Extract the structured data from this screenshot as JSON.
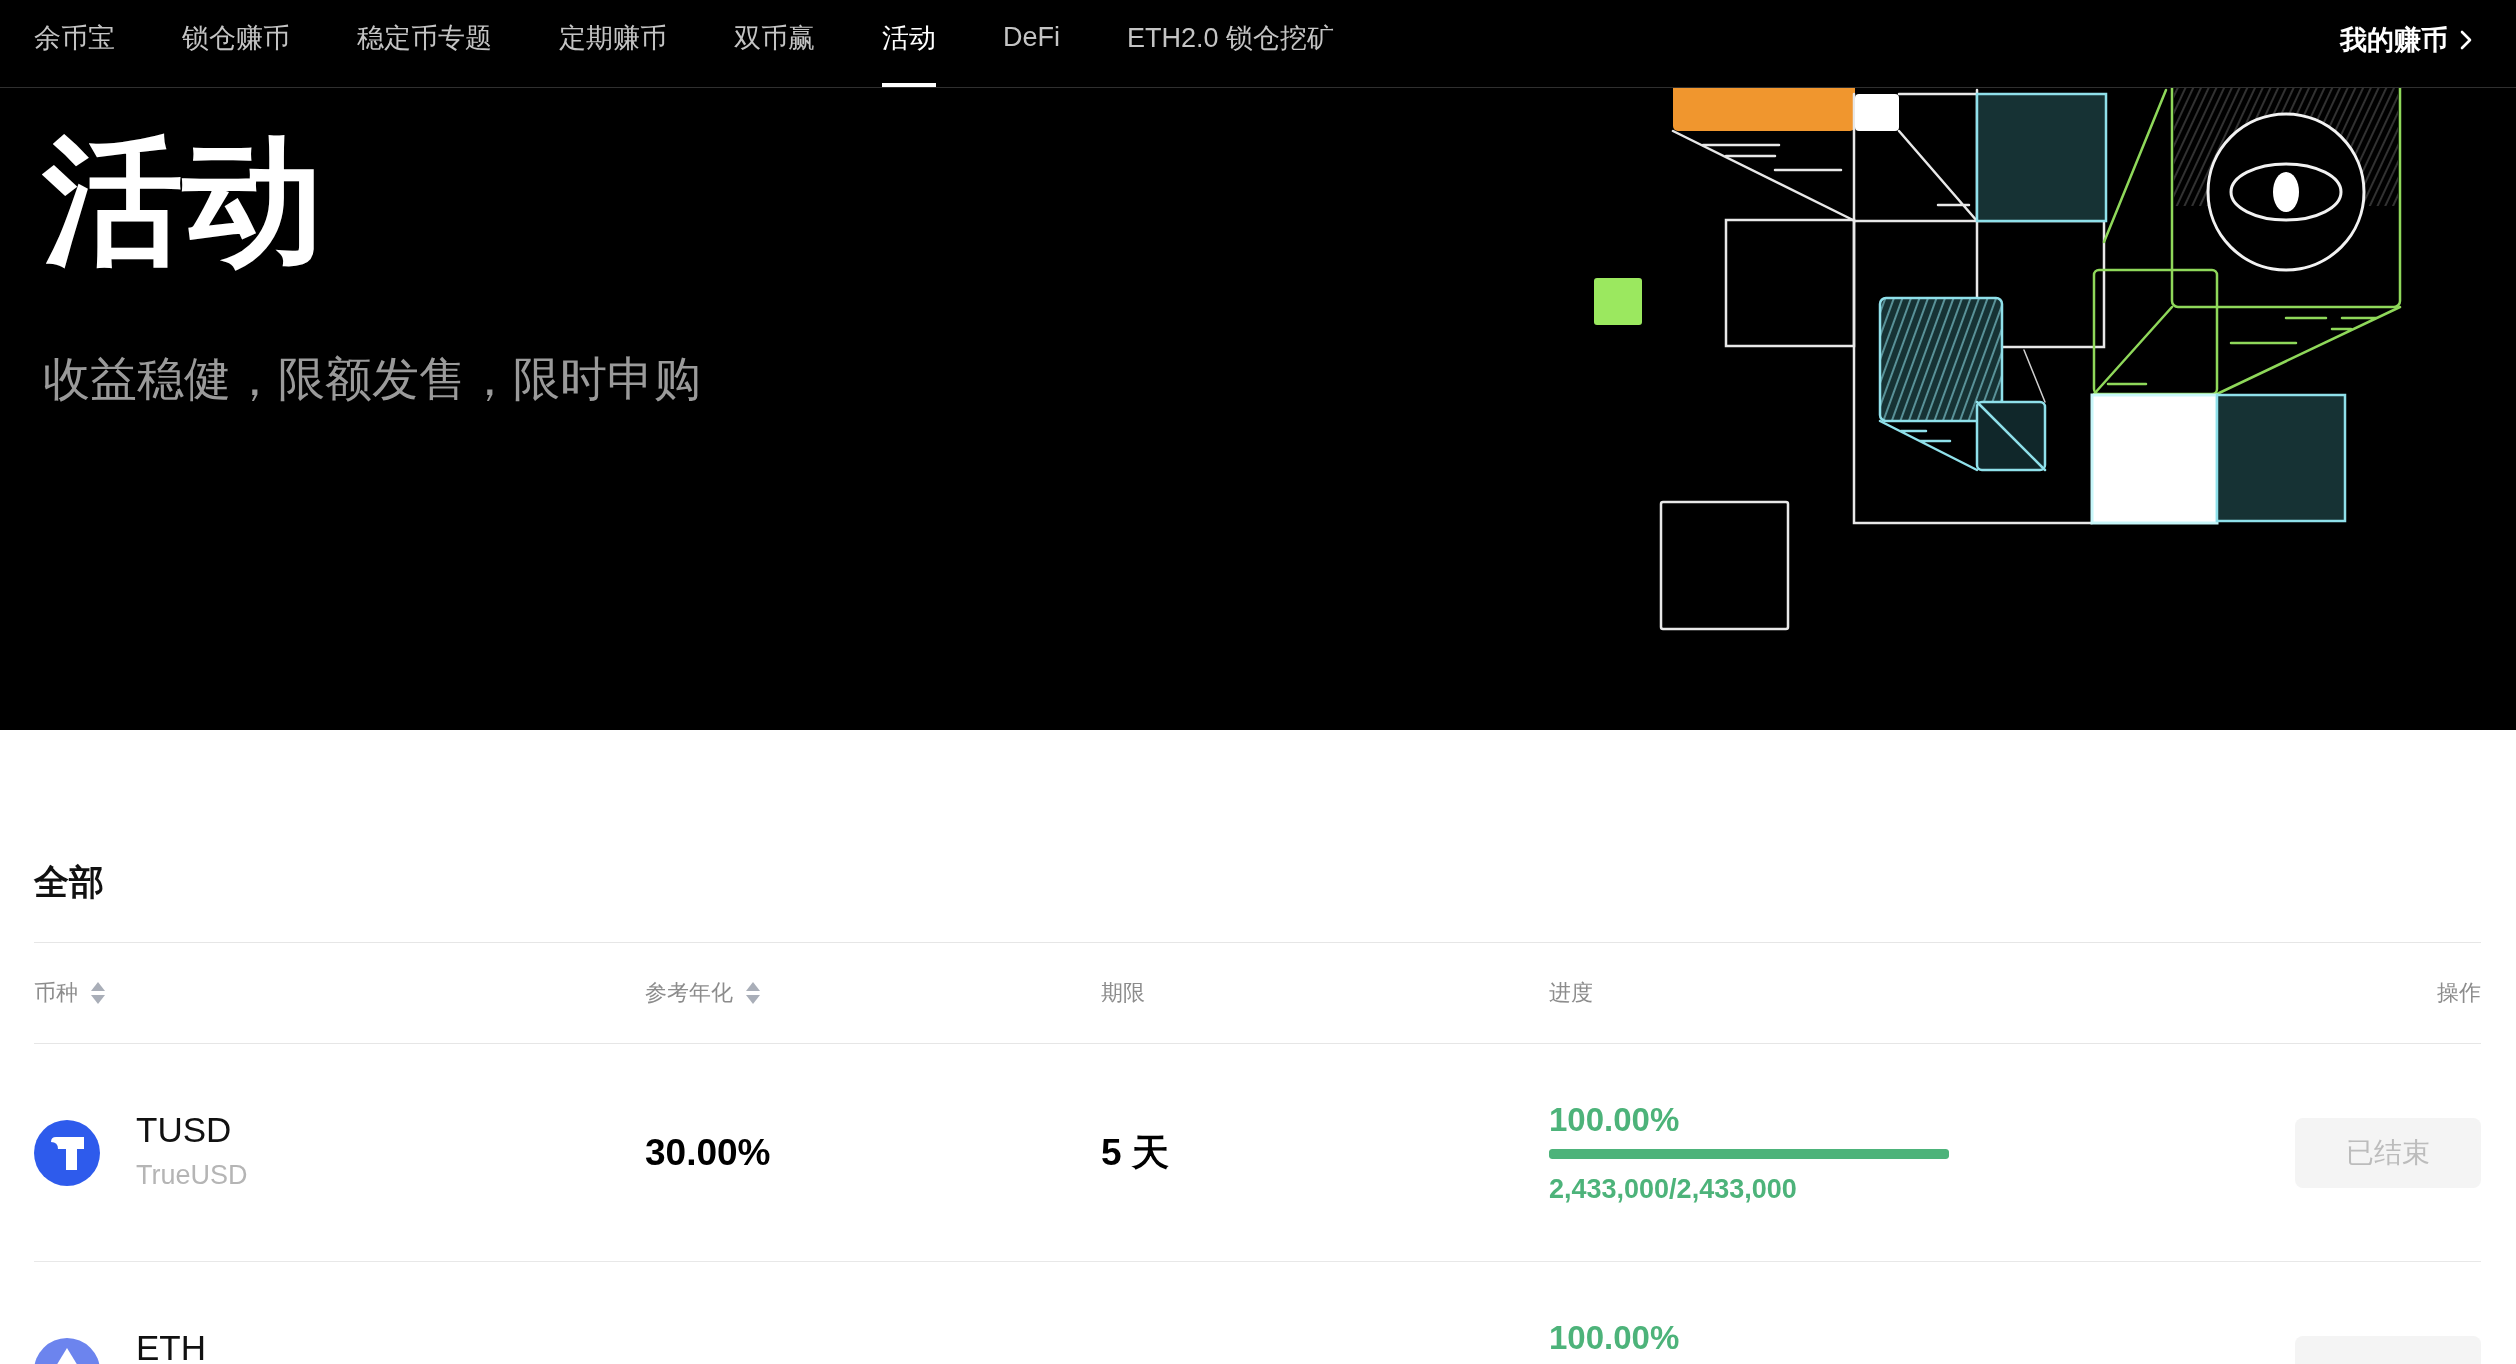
{
  "nav": {
    "tabs": [
      {
        "label": "余币宝",
        "selected": false
      },
      {
        "label": "锁仓赚币",
        "selected": false
      },
      {
        "label": "稳定币专题",
        "selected": false
      },
      {
        "label": "定期赚币",
        "selected": false
      },
      {
        "label": "双币赢",
        "selected": false
      },
      {
        "label": "活动",
        "selected": true
      },
      {
        "label": "DeFi",
        "selected": false
      },
      {
        "label": "ETH2.0 锁仓挖矿",
        "selected": false
      }
    ],
    "my_earnings": "我的赚币"
  },
  "hero": {
    "title": "活动",
    "subtitle": "收益稳健，限额发售，限时申购"
  },
  "section": {
    "title": "全部"
  },
  "table": {
    "columns": [
      {
        "label": "币种",
        "sortable": true
      },
      {
        "label": "参考年化",
        "sortable": true
      },
      {
        "label": "期限",
        "sortable": false
      },
      {
        "label": "进度",
        "sortable": false
      },
      {
        "label": "操作",
        "sortable": false
      }
    ],
    "rows": [
      {
        "coin": {
          "symbol": "TUSD",
          "name": "TrueUSD",
          "kind": "tusd",
          "color": "#2e5bec"
        },
        "apy": "30.00%",
        "term": "5 天",
        "progress": "100.00%",
        "level": 1,
        "amount": "2,433,000/2,433,000",
        "action": {
          "label": "已结束",
          "disabled": true
        }
      },
      {
        "coin": {
          "symbol": "ETH",
          "kind": "eth",
          "color": "#6c84ee"
        },
        "progress": "100.00%",
        "action": {
          "disabled": true
        }
      }
    ]
  }
}
